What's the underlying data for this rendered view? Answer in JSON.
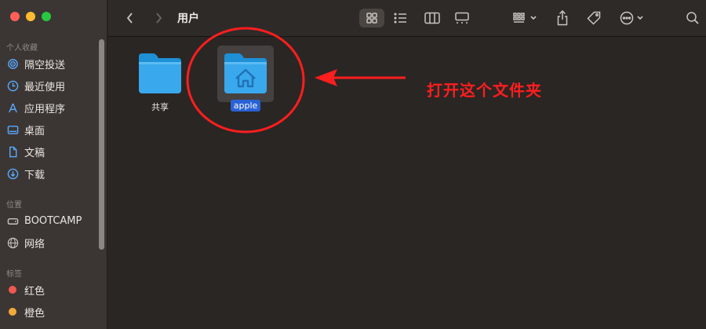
{
  "window": {
    "title": "用户"
  },
  "sidebar": {
    "sections": [
      {
        "title": "个人收藏",
        "items": [
          {
            "label": "隔空投送",
            "icon": "airdrop-icon"
          },
          {
            "label": "最近使用",
            "icon": "clock-icon"
          },
          {
            "label": "应用程序",
            "icon": "applications-icon"
          },
          {
            "label": "桌面",
            "icon": "desktop-icon"
          },
          {
            "label": "文稿",
            "icon": "document-icon"
          },
          {
            "label": "下载",
            "icon": "download-icon"
          }
        ]
      },
      {
        "title": "位置",
        "items": [
          {
            "label": "BOOTCAMP",
            "icon": "drive-icon"
          },
          {
            "label": "网络",
            "icon": "network-icon"
          }
        ]
      },
      {
        "title": "标签",
        "items": [
          {
            "label": "红色",
            "color": "#ff5f57"
          },
          {
            "label": "橙色",
            "color": "#febc2e"
          }
        ]
      }
    ]
  },
  "toolbar": {
    "view_modes": [
      "icon-view",
      "list-view",
      "column-view",
      "gallery-view"
    ],
    "active_view": "icon-view"
  },
  "files": [
    {
      "name": "共享",
      "type": "folder",
      "selected": false
    },
    {
      "name": "apple",
      "type": "home-folder",
      "selected": true
    }
  ],
  "annotation": {
    "text": "打开这个文件夹",
    "color": "#ff1e1e"
  }
}
